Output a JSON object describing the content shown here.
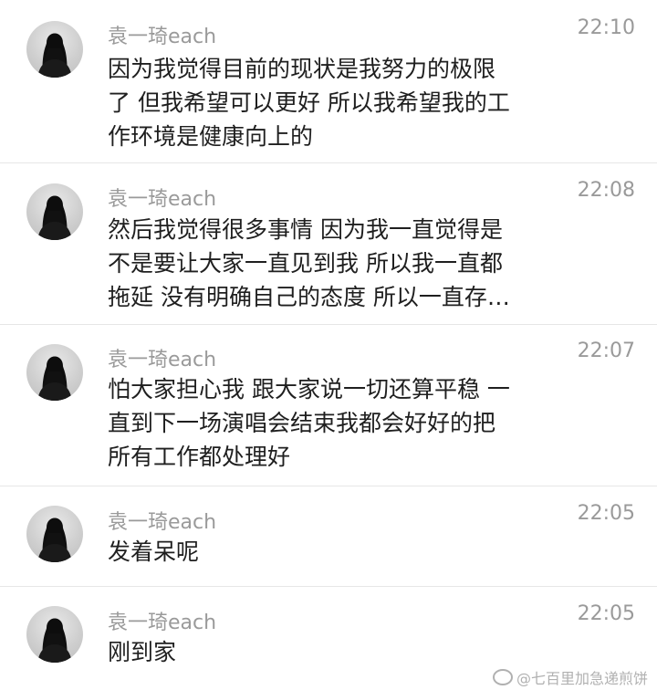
{
  "messages": [
    {
      "name": "袁一琦each",
      "time": "22:10",
      "lines": [
        "因为我觉得目前的现状是我努力的极限",
        "了 但我希望可以更好 所以我希望我的工",
        "作环境是健康向上的"
      ]
    },
    {
      "name": "袁一琦each",
      "time": "22:08",
      "lines": [
        "然后我觉得很多事情 因为我一直觉得是",
        "不是要让大家一直见到我 所以我一直都",
        "拖延 没有明确自己的态度 所以一直存…"
      ]
    },
    {
      "name": "袁一琦each",
      "time": "22:07",
      "lines": [
        "怕大家担心我 跟大家说一切还算平稳 一",
        "直到下一场演唱会结束我都会好好的把",
        "所有工作都处理好"
      ]
    },
    {
      "name": "袁一琦each",
      "time": "22:05",
      "lines": [
        "发着呆呢"
      ]
    },
    {
      "name": "袁一琦each",
      "time": "22:05",
      "lines": [
        "刚到家"
      ]
    }
  ],
  "watermark": "@七百里加急递煎饼"
}
